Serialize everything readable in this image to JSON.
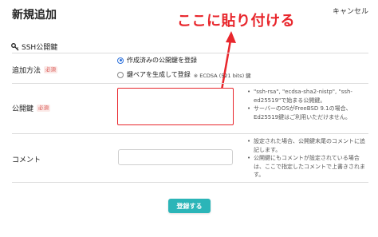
{
  "header": {
    "title": "新規追加",
    "cancel_label": "キャンセル"
  },
  "callout": {
    "text": "ここに貼り付ける",
    "color": "#e8262c"
  },
  "section": {
    "title": "SSH公開鍵",
    "icon": "key-icon"
  },
  "form": {
    "required_badge": "必須",
    "method": {
      "label": "追加方法",
      "options": [
        {
          "label": "作成済みの公開鍵を登録",
          "checked": true,
          "note": ""
        },
        {
          "label": "鍵ペアを生成して登録",
          "checked": false,
          "note": "※ ECDSA (521 bits) 鍵"
        }
      ]
    },
    "public_key": {
      "label": "公開鍵",
      "value": "",
      "help": [
        "\"ssh-rsa\", \"ecdsa-sha2-nistp\", \"ssh-ed25519\"で始まる公開鍵。",
        "サーバーのOSがFreeBSD 9.1の場合、Ed25519鍵はご利用いただけません。"
      ]
    },
    "comment": {
      "label": "コメント",
      "value": "",
      "help": [
        "設定された場合、公開鍵末尾のコメントに追記します。",
        "公開鍵にもコメントが設定されている場合は、ここで指定したコメントで上書きされます。"
      ]
    },
    "submit_label": "登録する"
  },
  "colors": {
    "accent": "#2bb5b8",
    "highlight": "#e8262c",
    "radio_selected": "#2a6fdb"
  }
}
